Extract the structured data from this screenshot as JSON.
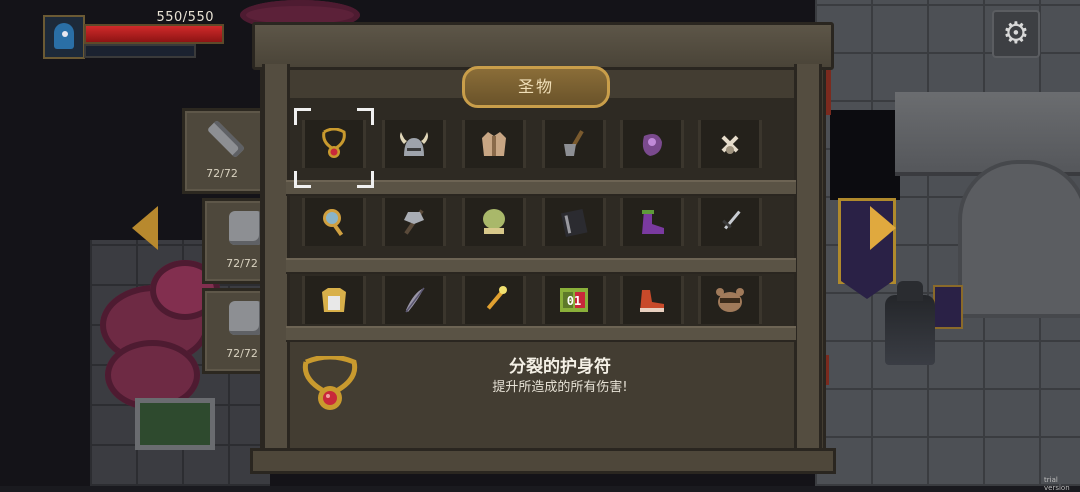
{
  "hud": {
    "hp_text": "550/550",
    "hp_fraction": 1.0,
    "settings_icon": "gear-icon"
  },
  "side_tabs": [
    {
      "name": "weapons",
      "icon": "sword-icon",
      "count": "72/72"
    },
    {
      "name": "armor",
      "icon": "shield-icon",
      "count": "72/72"
    },
    {
      "name": "relics",
      "icon": "pouch-icon",
      "count": "72/72"
    }
  ],
  "cabinet": {
    "title": "圣物",
    "rows": [
      [
        {
          "icon": "amulet-icon",
          "color": "#c99a2e",
          "accent": "#c8283a"
        },
        {
          "icon": "horned-helmet-icon",
          "color": "#9ea3ab",
          "accent": "#e0d6b8"
        },
        {
          "icon": "cloth-armor-icon",
          "color": "#c8a684",
          "accent": "#8a6a4a"
        },
        {
          "icon": "shovel-icon",
          "color": "#8d8f94",
          "accent": "#7a5a2e"
        },
        {
          "icon": "purple-gauntlet-icon",
          "color": "#7a4a8e",
          "accent": "#c08ad8"
        },
        {
          "icon": "bone-charm-icon",
          "color": "#e6dccb",
          "accent": "#9e927e"
        }
      ],
      [
        {
          "icon": "magic-mirror-icon",
          "color": "#d0a040",
          "accent": "#8ab4c8"
        },
        {
          "icon": "battle-axe-icon",
          "color": "#a9adb4",
          "accent": "#5a4a3a"
        },
        {
          "icon": "green-orb-icon",
          "color": "#a9b86a",
          "accent": "#d8c88a"
        },
        {
          "icon": "black-book-icon",
          "color": "#2b2b30",
          "accent": "#9a9aa0"
        },
        {
          "icon": "purple-boot-icon",
          "color": "#7a3aa0",
          "accent": "#5e9a3a"
        },
        {
          "icon": "dagger-icon",
          "color": "#c8ccd2",
          "accent": "#3a3a3a"
        }
      ],
      [
        {
          "icon": "golden-armor-icon",
          "color": "#d8b04a",
          "accent": "#e8e8e8"
        },
        {
          "icon": "feather-icon",
          "color": "#9a96a8",
          "accent": "#5a5670"
        },
        {
          "icon": "flaming-sword-icon",
          "color": "#e0a030",
          "accent": "#f0e070"
        },
        {
          "icon": "counter-box-icon",
          "color": "#8ab03a",
          "accent": "#c8283a"
        },
        {
          "icon": "red-shoe-icon",
          "color": "#c84a2a",
          "accent": "#e8d0c0"
        },
        {
          "icon": "raccoon-mask-icon",
          "color": "#a07a5a",
          "accent": "#3a2a1a"
        }
      ]
    ],
    "counter_box_text": "01"
  },
  "selected_item": {
    "name": "分裂的护身符",
    "description": "提升所造成的所有伤害!",
    "icon": "amulet-icon"
  },
  "watermark": "trial version"
}
